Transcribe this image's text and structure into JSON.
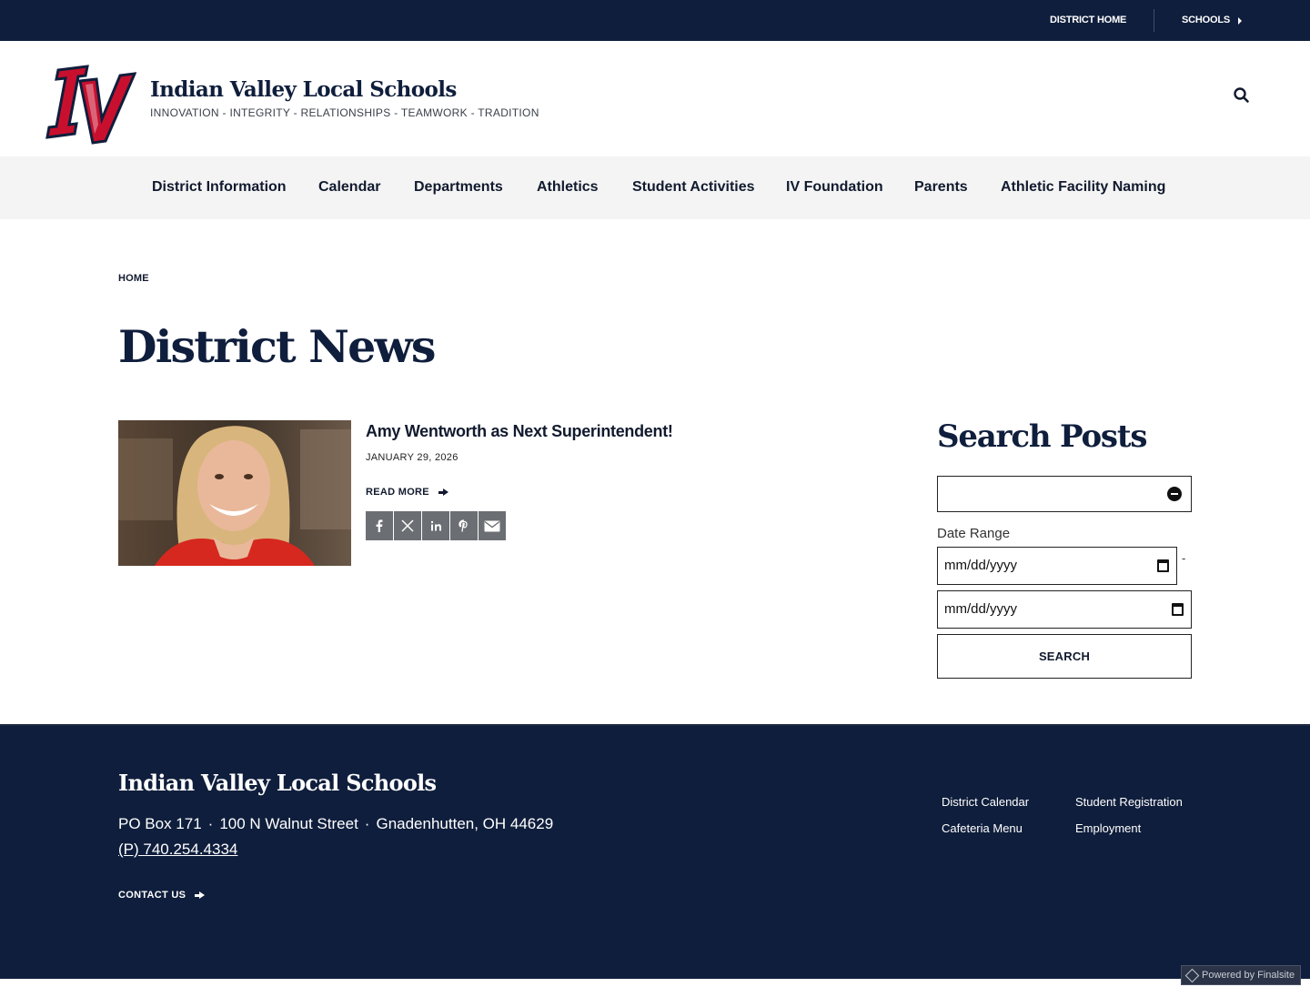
{
  "utility": {
    "district_home": "DISTRICT HOME",
    "schools": "SCHOOLS"
  },
  "header": {
    "title": "Indian Valley Local Schools",
    "tagline": "INNOVATION - INTEGRITY - RELATIONSHIPS - TEAMWORK - TRADITION",
    "logo_text": "IV"
  },
  "nav": {
    "items": [
      "District Information",
      "Calendar",
      "Departments",
      "Athletics",
      "Student Activities",
      "IV Foundation",
      "Parents",
      "Athletic Facility Naming"
    ]
  },
  "breadcrumb": {
    "home": "HOME"
  },
  "page": {
    "title": "District News"
  },
  "post": {
    "title": "Amy Wentworth as Next Superintendent!",
    "date": "JANUARY 29, 2026",
    "read_more": "READ MORE",
    "share_icons": [
      "facebook-icon",
      "x-icon",
      "linkedin-icon",
      "pinterest-icon",
      "email-icon"
    ]
  },
  "sidebar": {
    "title": "Search Posts",
    "search_value": "",
    "date_range_label": "Date Range",
    "date_from": "mm/dd/yyyy",
    "date_to": "mm/dd/yyyy",
    "separator": "-",
    "search_button": "SEARCH"
  },
  "footer": {
    "title": "Indian Valley Local Schools",
    "po_box": "PO Box 171",
    "street": "100 N Walnut Street",
    "city": "Gnadenhutten, OH  44629",
    "phone": "(P) 740.254.4334",
    "contact": "CONTACT US",
    "links": [
      "District Calendar",
      "Student Registration",
      "Cafeteria Menu",
      "Employment"
    ]
  },
  "powered_by": "Powered by Finalsite",
  "colors": {
    "navy": "#0f1e3c",
    "brand_red": "#c8102e",
    "nav_bg": "#f4f4f4",
    "share_gray": "#6b6e73"
  }
}
